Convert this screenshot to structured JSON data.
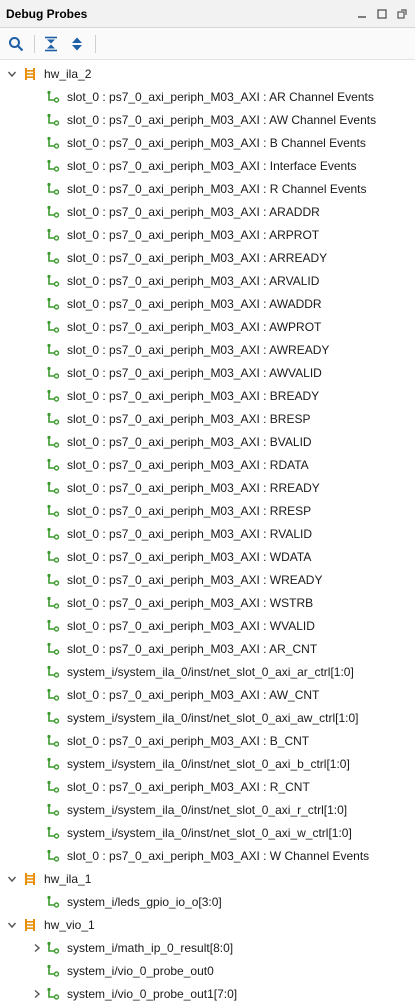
{
  "panel": {
    "title": "Debug Probes"
  },
  "toolbar": {
    "buttons": [
      {
        "name": "search-button",
        "icon": "search-icon"
      },
      {
        "name": "collapse-all-button",
        "icon": "collapse-all-icon"
      },
      {
        "name": "expand-all-button",
        "icon": "expand-all-icon"
      }
    ]
  },
  "colors": {
    "core_icon": "#e8900c",
    "probe_icon": "#3c9a2e",
    "caret": "#555555",
    "toolbar_icon": "#1f5fa6"
  },
  "tree": [
    {
      "level": 0,
      "label": "hw_ila_2",
      "icon": "ila-core-icon",
      "expander": "expanded"
    },
    {
      "level": 1,
      "label": "slot_0 : ps7_0_axi_periph_M03_AXI : AR Channel  Events",
      "icon": "probe-icon",
      "expander": "none"
    },
    {
      "level": 1,
      "label": "slot_0 : ps7_0_axi_periph_M03_AXI : AW Channel  Events",
      "icon": "probe-icon",
      "expander": "none"
    },
    {
      "level": 1,
      "label": "slot_0 : ps7_0_axi_periph_M03_AXI : B Channel  Events",
      "icon": "probe-icon",
      "expander": "none"
    },
    {
      "level": 1,
      "label": "slot_0 : ps7_0_axi_periph_M03_AXI : Interface  Events",
      "icon": "probe-icon",
      "expander": "none"
    },
    {
      "level": 1,
      "label": "slot_0 : ps7_0_axi_periph_M03_AXI : R Channel  Events",
      "icon": "probe-icon",
      "expander": "none"
    },
    {
      "level": 1,
      "label": "slot_0 : ps7_0_axi_periph_M03_AXI : ARADDR",
      "icon": "probe-icon",
      "expander": "none"
    },
    {
      "level": 1,
      "label": "slot_0 : ps7_0_axi_periph_M03_AXI : ARPROT",
      "icon": "probe-icon",
      "expander": "none"
    },
    {
      "level": 1,
      "label": "slot_0 : ps7_0_axi_periph_M03_AXI : ARREADY",
      "icon": "probe-icon",
      "expander": "none"
    },
    {
      "level": 1,
      "label": "slot_0 : ps7_0_axi_periph_M03_AXI : ARVALID",
      "icon": "probe-icon",
      "expander": "none"
    },
    {
      "level": 1,
      "label": "slot_0 : ps7_0_axi_periph_M03_AXI : AWADDR",
      "icon": "probe-icon",
      "expander": "none"
    },
    {
      "level": 1,
      "label": "slot_0 : ps7_0_axi_periph_M03_AXI : AWPROT",
      "icon": "probe-icon",
      "expander": "none"
    },
    {
      "level": 1,
      "label": "slot_0 : ps7_0_axi_periph_M03_AXI : AWREADY",
      "icon": "probe-icon",
      "expander": "none"
    },
    {
      "level": 1,
      "label": "slot_0 : ps7_0_axi_periph_M03_AXI : AWVALID",
      "icon": "probe-icon",
      "expander": "none"
    },
    {
      "level": 1,
      "label": "slot_0 : ps7_0_axi_periph_M03_AXI : BREADY",
      "icon": "probe-icon",
      "expander": "none"
    },
    {
      "level": 1,
      "label": "slot_0 : ps7_0_axi_periph_M03_AXI : BRESP",
      "icon": "probe-icon",
      "expander": "none"
    },
    {
      "level": 1,
      "label": "slot_0 : ps7_0_axi_periph_M03_AXI : BVALID",
      "icon": "probe-icon",
      "expander": "none"
    },
    {
      "level": 1,
      "label": "slot_0 : ps7_0_axi_periph_M03_AXI : RDATA",
      "icon": "probe-icon",
      "expander": "none"
    },
    {
      "level": 1,
      "label": "slot_0 : ps7_0_axi_periph_M03_AXI : RREADY",
      "icon": "probe-icon",
      "expander": "none"
    },
    {
      "level": 1,
      "label": "slot_0 : ps7_0_axi_periph_M03_AXI : RRESP",
      "icon": "probe-icon",
      "expander": "none"
    },
    {
      "level": 1,
      "label": "slot_0 : ps7_0_axi_periph_M03_AXI : RVALID",
      "icon": "probe-icon",
      "expander": "none"
    },
    {
      "level": 1,
      "label": "slot_0 : ps7_0_axi_periph_M03_AXI : WDATA",
      "icon": "probe-icon",
      "expander": "none"
    },
    {
      "level": 1,
      "label": "slot_0 : ps7_0_axi_periph_M03_AXI : WREADY",
      "icon": "probe-icon",
      "expander": "none"
    },
    {
      "level": 1,
      "label": "slot_0 : ps7_0_axi_periph_M03_AXI : WSTRB",
      "icon": "probe-icon",
      "expander": "none"
    },
    {
      "level": 1,
      "label": "slot_0 : ps7_0_axi_periph_M03_AXI : WVALID",
      "icon": "probe-icon",
      "expander": "none"
    },
    {
      "level": 1,
      "label": "slot_0 : ps7_0_axi_periph_M03_AXI : AR_CNT",
      "icon": "probe-icon",
      "expander": "none"
    },
    {
      "level": 1,
      "label": "system_i/system_ila_0/inst/net_slot_0_axi_ar_ctrl[1:0]",
      "icon": "probe-icon",
      "expander": "none"
    },
    {
      "level": 1,
      "label": "slot_0 : ps7_0_axi_periph_M03_AXI : AW_CNT",
      "icon": "probe-icon",
      "expander": "none"
    },
    {
      "level": 1,
      "label": "system_i/system_ila_0/inst/net_slot_0_axi_aw_ctrl[1:0]",
      "icon": "probe-icon",
      "expander": "none"
    },
    {
      "level": 1,
      "label": "slot_0 : ps7_0_axi_periph_M03_AXI : B_CNT",
      "icon": "probe-icon",
      "expander": "none"
    },
    {
      "level": 1,
      "label": "system_i/system_ila_0/inst/net_slot_0_axi_b_ctrl[1:0]",
      "icon": "probe-icon",
      "expander": "none"
    },
    {
      "level": 1,
      "label": "slot_0 : ps7_0_axi_periph_M03_AXI : R_CNT",
      "icon": "probe-icon",
      "expander": "none"
    },
    {
      "level": 1,
      "label": "system_i/system_ila_0/inst/net_slot_0_axi_r_ctrl[1:0]",
      "icon": "probe-icon",
      "expander": "none"
    },
    {
      "level": 1,
      "label": "system_i/system_ila_0/inst/net_slot_0_axi_w_ctrl[1:0]",
      "icon": "probe-icon",
      "expander": "none"
    },
    {
      "level": 1,
      "label": "slot_0 : ps7_0_axi_periph_M03_AXI : W Channel  Events",
      "icon": "probe-icon",
      "expander": "none"
    },
    {
      "level": 0,
      "label": "hw_ila_1",
      "icon": "ila-core-icon",
      "expander": "expanded"
    },
    {
      "level": 1,
      "label": "system_i/leds_gpio_io_o[3:0]",
      "icon": "probe-icon",
      "expander": "none"
    },
    {
      "level": 0,
      "label": "hw_vio_1",
      "icon": "vio-core-icon",
      "expander": "expanded"
    },
    {
      "level": 1,
      "label": "system_i/math_ip_0_result[8:0]",
      "icon": "probe-icon",
      "expander": "collapsed"
    },
    {
      "level": 1,
      "label": "system_i/vio_0_probe_out0",
      "icon": "probe-icon",
      "expander": "none"
    },
    {
      "level": 1,
      "label": "system_i/vio_0_probe_out1[7:0]",
      "icon": "probe-icon",
      "expander": "collapsed"
    }
  ]
}
